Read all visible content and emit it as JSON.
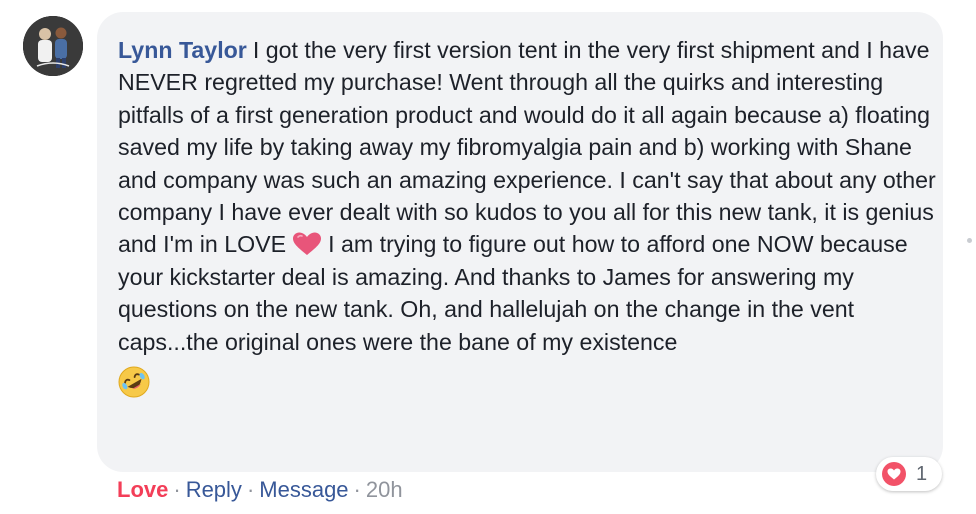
{
  "comment": {
    "author": "Lynn Taylor",
    "text_part1": "I got the very first version tent in the very first shipment and I have NEVER regretted my purchase! Went through all the quirks and interesting pitfalls of a first generation product and would do it all again because a) floating saved my life by taking away my fibromyalgia pain and b) working with Shane and company was such an amazing experience. I can't say that about any other company I have ever dealt with so kudos to you all for this new tank, it is genius and I'm in LOVE",
    "text_part2": "I am trying to figure out how to afford one NOW because your kickstarter deal is amazing. And thanks to James for answering my questions on the new tank. Oh, and hallelujah on the change in the vent caps...the original ones were the bane of my existence",
    "inline_emoji": "heart-emoji",
    "trailing_emoji": "rolling-on-floor-laughing-emoji"
  },
  "actions": {
    "love_label": "Love",
    "reply_label": "Reply",
    "message_label": "Message",
    "timestamp": "20h",
    "separator": "·"
  },
  "reactions": {
    "icon": "heart-icon",
    "count": "1"
  },
  "colors": {
    "author": "#385898",
    "love": "#f33e58",
    "bubble": "#f2f3f5",
    "text": "#1d2129",
    "meta": "#90949c"
  }
}
